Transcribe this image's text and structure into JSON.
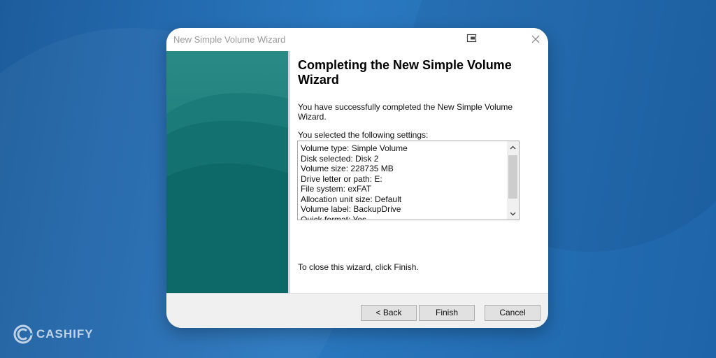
{
  "window": {
    "title": "New Simple Volume Wizard"
  },
  "main": {
    "heading": "Completing the New Simple Volume Wizard",
    "success_text": "You have successfully completed the New Simple Volume Wizard.",
    "settings_label": "You selected the following settings:",
    "settings": [
      "Volume type: Simple Volume",
      "Disk selected: Disk 2",
      "Volume size: 228735 MB",
      "Drive letter or path: E:",
      "File system: exFAT",
      "Allocation unit size: Default",
      "Volume label: BackupDrive",
      "Quick format: Yes"
    ],
    "close_hint": "To close this wizard, click Finish."
  },
  "footer": {
    "back_label": "< Back",
    "finish_label": "Finish",
    "cancel_label": "Cancel"
  },
  "brand": {
    "logo_text": "CASHIFY"
  },
  "icons": {
    "help": "help-icon",
    "close": "close-icon",
    "scroll_up": "chevron-up-icon",
    "scroll_down": "chevron-down-icon",
    "logo": "cashify-logo-icon"
  },
  "colors": {
    "background": "#1f62a3",
    "side_panel": "#1f7f7c",
    "footer": "#f0f0f0"
  }
}
